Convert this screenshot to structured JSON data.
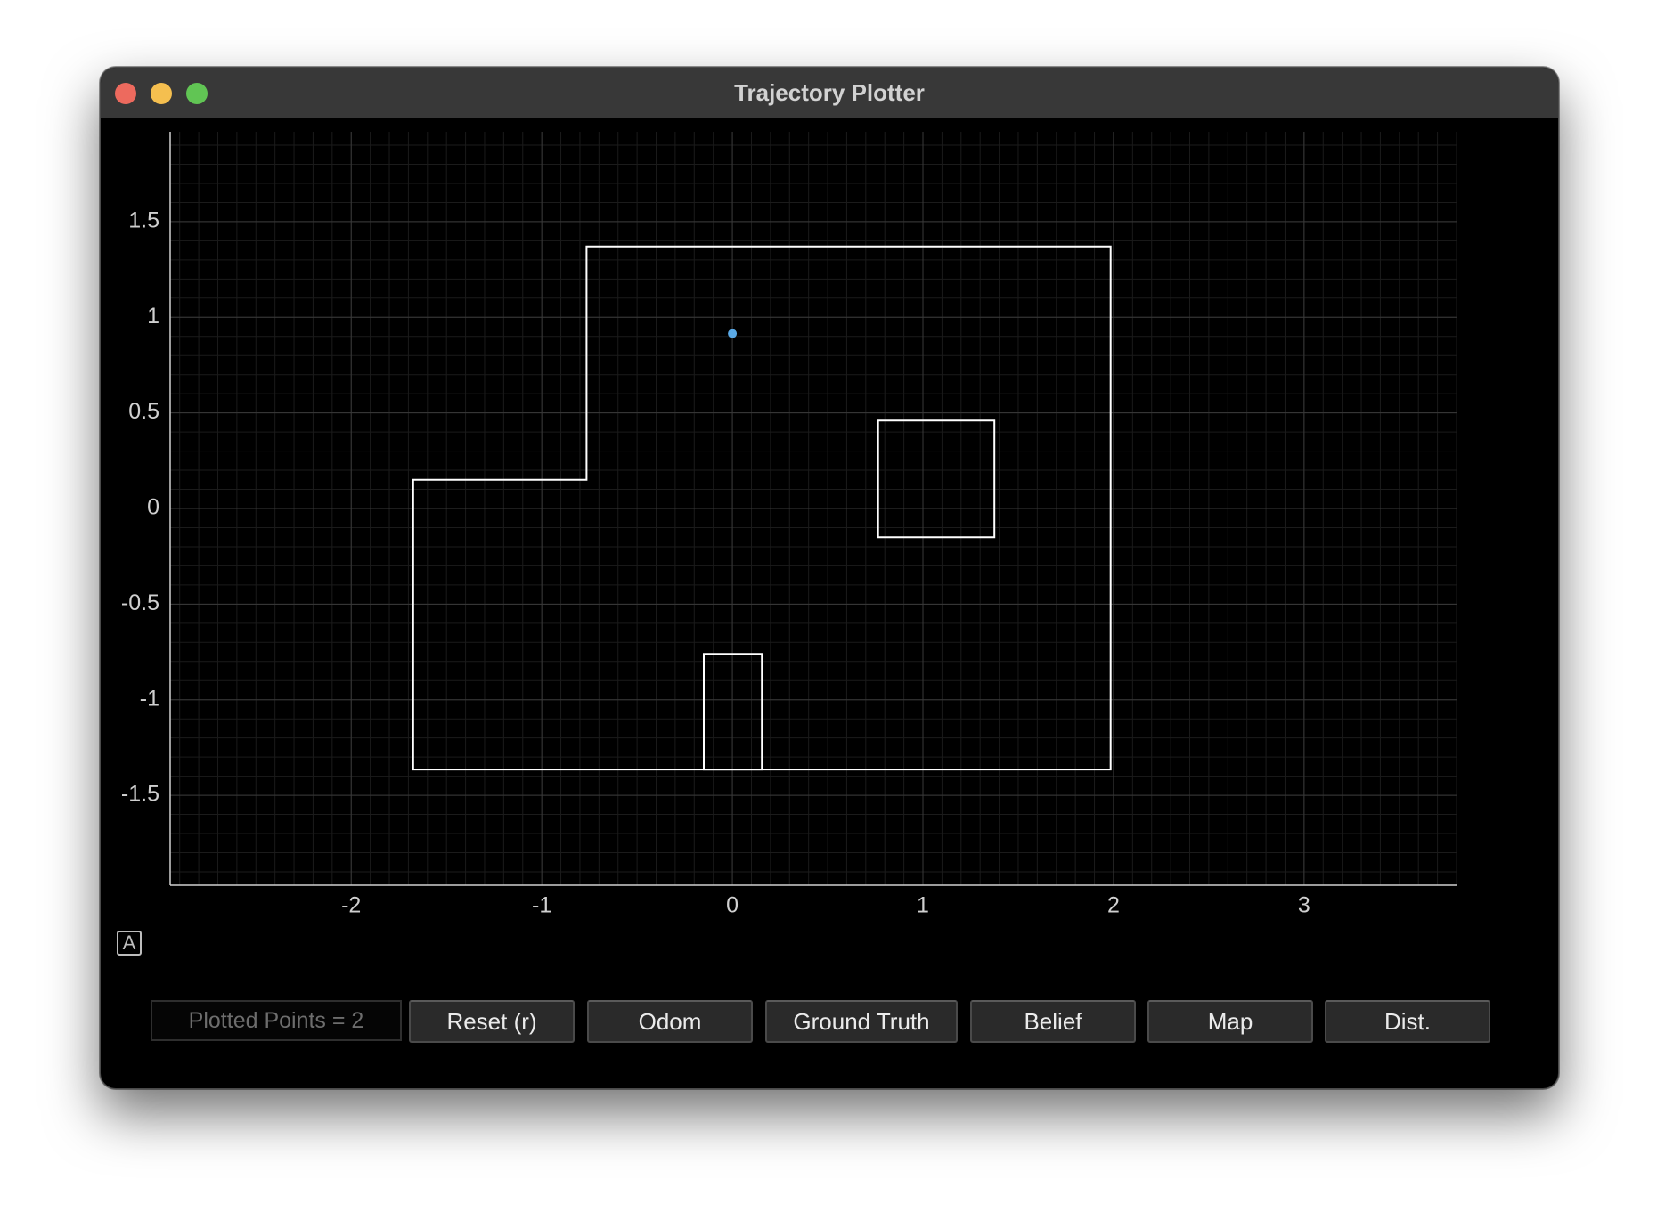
{
  "window": {
    "title": "Trajectory Plotter"
  },
  "toolbar": {
    "status_text": "Plotted Points = 2",
    "buttons": [
      {
        "id": "reset",
        "label": "Reset (r)"
      },
      {
        "id": "odom",
        "label": "Odom"
      },
      {
        "id": "ground_truth",
        "label": "Ground Truth"
      },
      {
        "id": "belief",
        "label": "Belief"
      },
      {
        "id": "map",
        "label": "Map"
      },
      {
        "id": "dist",
        "label": "Dist."
      }
    ],
    "autoscale_glyph": "A"
  },
  "chart_data": {
    "type": "scatter",
    "title": "",
    "xlabel": "",
    "ylabel": "",
    "xlim": [
      -2.95,
      3.8
    ],
    "ylim": [
      -1.97,
      1.97
    ],
    "x_ticks": [
      -2,
      -1,
      0,
      1,
      2,
      3
    ],
    "x_tick_labels": [
      "-2",
      "-1",
      "0",
      "1",
      "2",
      "3"
    ],
    "y_ticks": [
      1.5,
      1,
      0.5,
      0,
      -0.5,
      -1,
      -1.5
    ],
    "y_tick_labels": [
      "1.5",
      "1",
      "0.5",
      "0",
      "-0.5",
      "-1",
      "-1.5"
    ],
    "grid": true,
    "minor_grid_step": 0.1,
    "colors": {
      "background": "#000000",
      "map": "#ffffff",
      "point": "#5aa9e6",
      "major_grid": "#3a3a3a",
      "minor_grid": "#1b1b1b",
      "tick_label": "#d0d0d0",
      "axis": "#cfcfcf"
    },
    "series": [
      {
        "kind": "map_polygon",
        "points": [
          [
            -1.675,
            -1.365
          ],
          [
            1.985,
            -1.365
          ],
          [
            1.985,
            1.37
          ],
          [
            -0.765,
            1.37
          ],
          [
            -0.765,
            0.15
          ],
          [
            -1.675,
            0.15
          ]
        ]
      },
      {
        "kind": "map_polygon",
        "points": [
          [
            0.765,
            -0.15
          ],
          [
            1.375,
            -0.15
          ],
          [
            1.375,
            0.46
          ],
          [
            0.765,
            0.46
          ]
        ]
      },
      {
        "kind": "map_polygon",
        "points": [
          [
            -0.15,
            -1.365
          ],
          [
            0.155,
            -1.365
          ],
          [
            0.155,
            -0.76
          ],
          [
            -0.15,
            -0.76
          ]
        ]
      },
      {
        "kind": "points",
        "points": [
          [
            0.0,
            0.915
          ]
        ]
      }
    ]
  }
}
